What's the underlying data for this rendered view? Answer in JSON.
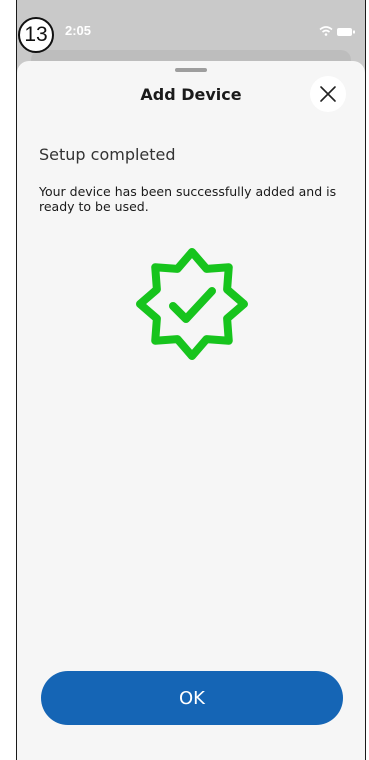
{
  "status_bar": {
    "time": "2:05",
    "step_badge": "13",
    "wifi_icon": "wifi-icon",
    "battery_icon": "battery-icon"
  },
  "sheet": {
    "title": "Add Device",
    "close_icon": "close-icon",
    "heading": "Setup completed",
    "message": "Your device has been successfully added and is ready to be used.",
    "success_icon": "verified-badge-check-icon",
    "ok_label": "OK"
  },
  "colors": {
    "accent": "#1565b5",
    "success": "#17c41d",
    "sheet_background": "#f6f6f6"
  }
}
